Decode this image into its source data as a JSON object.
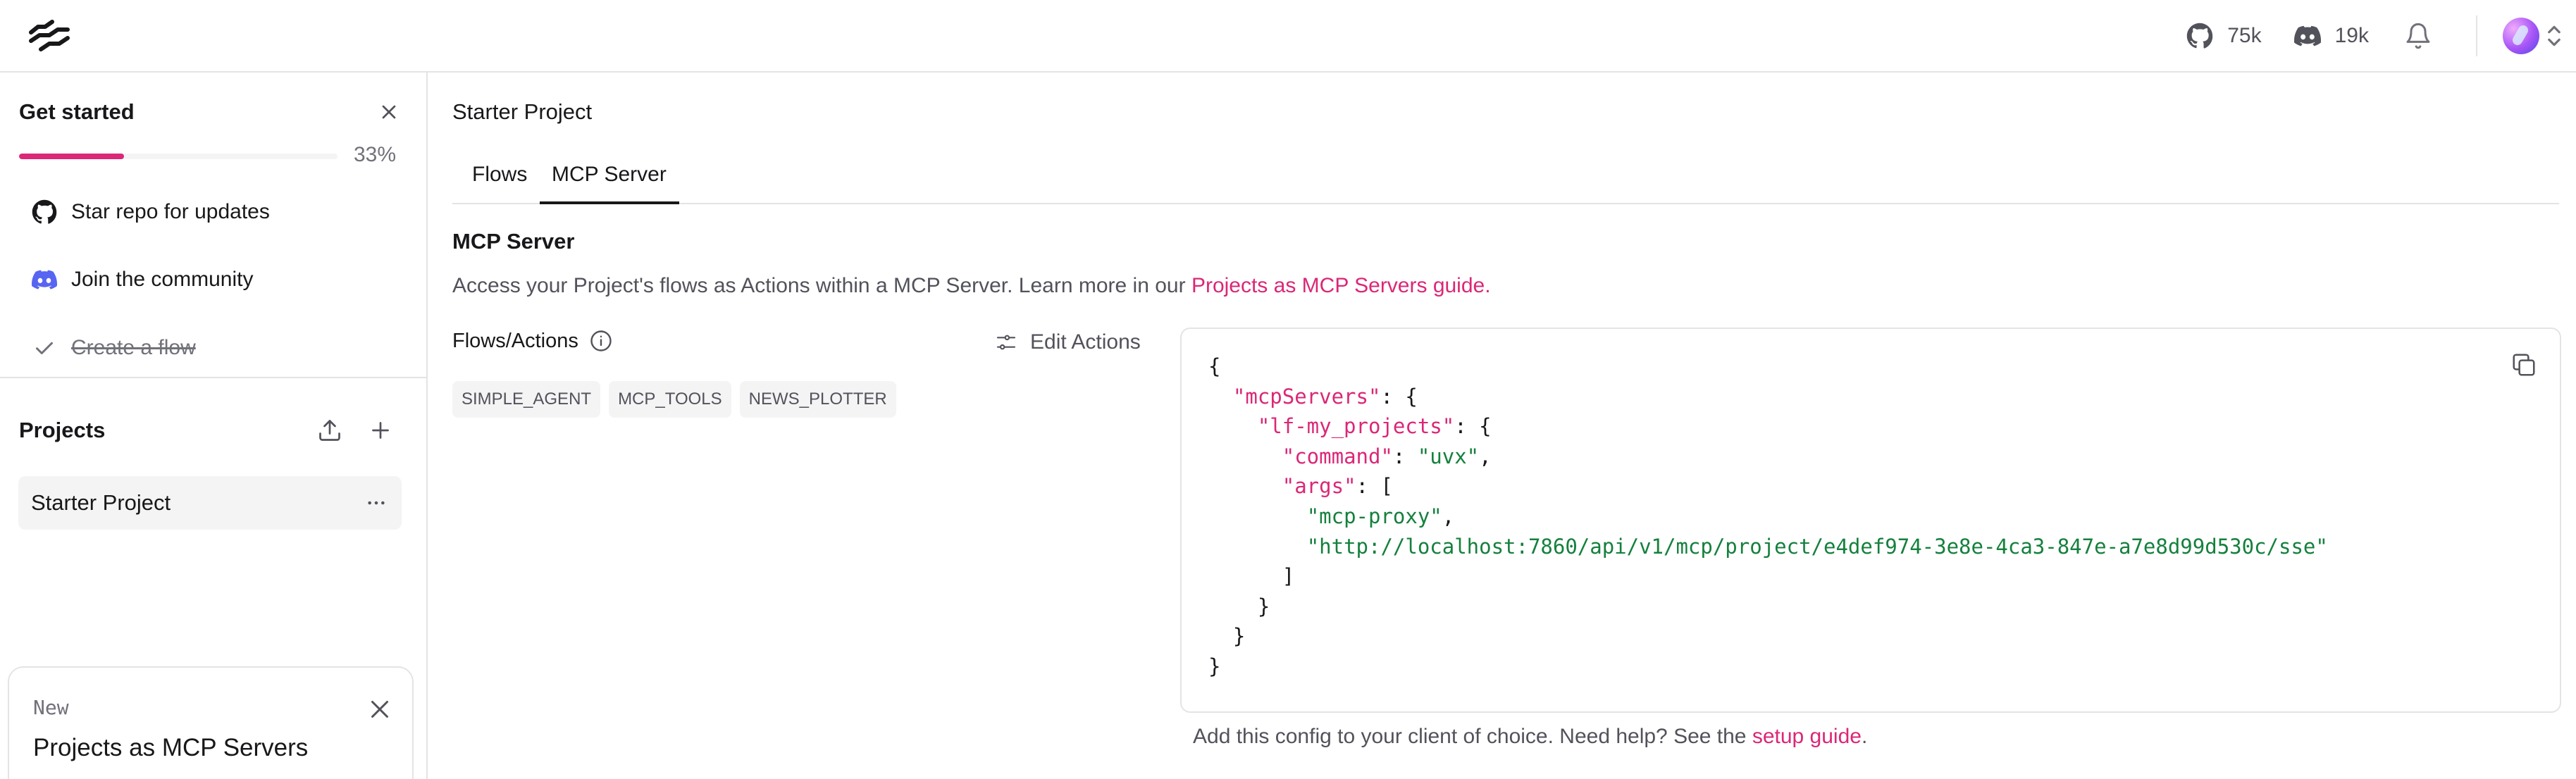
{
  "header": {
    "github_count": "75k",
    "discord_count": "19k",
    "accent_color": "#db2777"
  },
  "sidebar": {
    "get_started_title": "Get started",
    "progress_percent": 33,
    "progress_label": "33%",
    "items": [
      {
        "label": "Star repo for updates",
        "icon": "github-icon",
        "done": false
      },
      {
        "label": "Join the community",
        "icon": "discord-icon",
        "done": false
      },
      {
        "label": "Create a flow",
        "icon": "check-icon",
        "done": true
      }
    ],
    "projects_title": "Projects",
    "projects": [
      {
        "label": "Starter Project",
        "selected": true
      }
    ],
    "new_card": {
      "badge": "New",
      "title": "Projects as MCP Servers"
    }
  },
  "main": {
    "title": "Starter Project",
    "tabs": [
      {
        "label": "Flows",
        "active": false
      },
      {
        "label": "MCP Server",
        "active": true
      }
    ],
    "section_title": "MCP Server",
    "description_prefix": "Access your Project's flows as Actions within a MCP Server. Learn more in our ",
    "description_link": "Projects as MCP Servers guide.",
    "flows_actions_label": "Flows/Actions",
    "edit_actions_label": "Edit Actions",
    "chips": [
      "SIMPLE_AGENT",
      "MCP_TOOLS",
      "NEWS_PLOTTER"
    ],
    "code": {
      "servers_key": "\"mcpServers\"",
      "project_key": "\"lf-my_projects\"",
      "command_key": "\"command\"",
      "command_value": "\"uvx\"",
      "args_key": "\"args\"",
      "arg1": "\"mcp-proxy\"",
      "arg2": "\"http://localhost:7860/api/v1/mcp/project/e4def974-3e8e-4ca3-847e-a7e8d99d530c/sse\""
    },
    "footer_prefix": "Add this config to your client of choice. Need help? See the ",
    "footer_link": "setup guide",
    "footer_suffix": "."
  }
}
